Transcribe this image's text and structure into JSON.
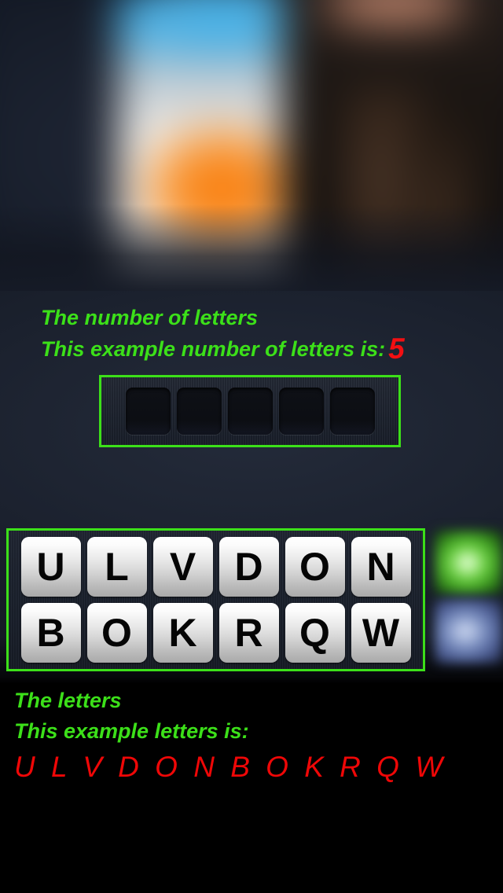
{
  "app": {
    "background_color": "#000000",
    "panel_color": "#1b212e",
    "accent_green": "#3ce019",
    "accent_red": "#ef0707"
  },
  "puzzle_image": {
    "alt": "blurred puzzle photo",
    "left_colors": [
      "#45b3ea",
      "#f4f0ea",
      "#f97a0e"
    ],
    "right_colors": [
      "#c08870",
      "#33241a",
      "#120f0e"
    ]
  },
  "hint": {
    "title": "The number of letters",
    "example_label": "This example number of letters is:",
    "count": "5"
  },
  "answer_slots": {
    "count": 5,
    "values": [
      "",
      "",
      "",
      "",
      ""
    ]
  },
  "tiles": {
    "row1": [
      "U",
      "L",
      "V",
      "D",
      "O",
      "N"
    ],
    "row2": [
      "B",
      "O",
      "K",
      "R",
      "Q",
      "W"
    ]
  },
  "side_buttons": [
    {
      "name": "hint-button",
      "color": "#64c93c"
    },
    {
      "name": "facebook-share-button",
      "color": "#6f83b6"
    }
  ],
  "answer_text": {
    "title": "The letters",
    "example_label": "This example letters is:",
    "letters": "U L V D O N B O K R Q W"
  }
}
